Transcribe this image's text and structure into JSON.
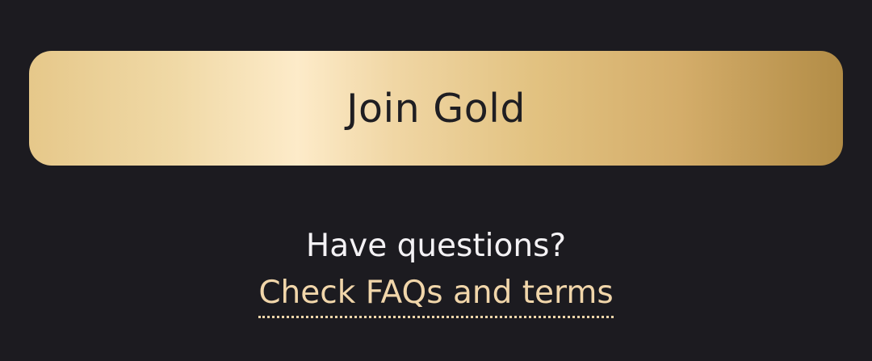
{
  "cta": {
    "label": "Join Gold"
  },
  "help": {
    "question": "Have questions?",
    "link_label": "Check FAQs and terms"
  },
  "colors": {
    "background": "#1c1b20",
    "gold_gradient_start": "#e6c88a",
    "gold_gradient_end": "#b28c46",
    "link": "#f1d6aa",
    "text": "#f4f2f5"
  }
}
